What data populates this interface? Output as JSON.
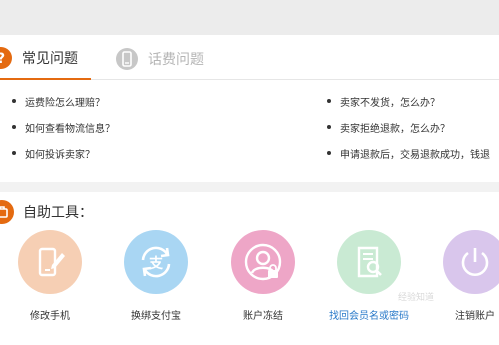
{
  "tabs": [
    {
      "label": "常见问题",
      "active": true
    },
    {
      "label": "话费问题",
      "active": false
    }
  ],
  "faq_left": [
    "运费险怎么理赔？",
    "如何查看物流信息？",
    "如何投诉卖家？"
  ],
  "faq_right": [
    "卖家不发货，怎么办？",
    "卖家拒绝退款，怎么办？",
    "申请退款后，交易退款成功，钱退"
  ],
  "tools_title": "自助工具：",
  "tools": [
    {
      "label": "修改手机",
      "icon": "phone-edit-icon",
      "color": "#f6cfb4"
    },
    {
      "label": "换绑支付宝",
      "icon": "alipay-exchange-icon",
      "color": "#a9d6f3"
    },
    {
      "label": "账户冻结",
      "icon": "user-lock-icon",
      "color": "#eea6c7"
    },
    {
      "label": "找回会员名或密码",
      "icon": "document-search-icon",
      "color": "#c9ead3",
      "highlight": true
    },
    {
      "label": "注销账户",
      "icon": "power-icon",
      "color": "#d9c6ec"
    }
  ],
  "watermark": "经验知道",
  "colors": {
    "accent": "#e46a10",
    "link": "#2a7ac9"
  }
}
